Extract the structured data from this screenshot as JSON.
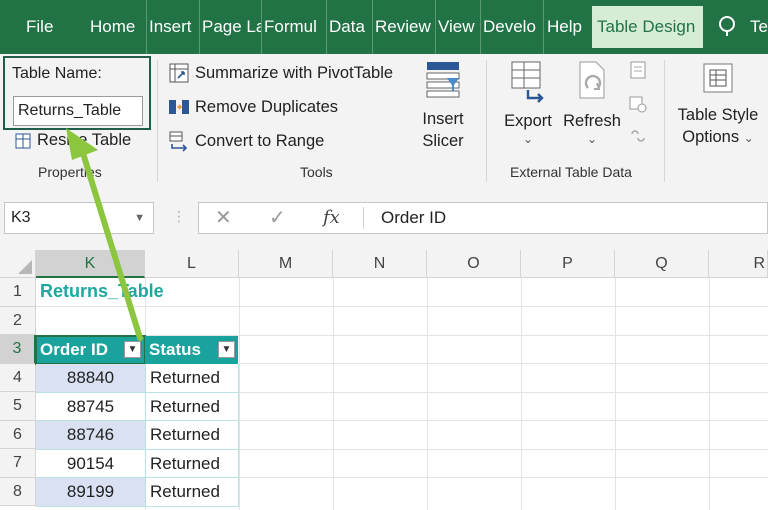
{
  "ribbon": {
    "tabs": [
      "File",
      "Home",
      "Insert",
      "Page La",
      "Formul",
      "Data",
      "Review",
      "View",
      "Develo",
      "Help",
      "Table Design",
      "Te"
    ],
    "properties": {
      "table_name_label": "Table Name:",
      "table_name_value": "Returns_Table",
      "resize_table": "Resize Table",
      "group_label": "Properties"
    },
    "tools": {
      "summarize": "Summarize with PivotTable",
      "remove_duplicates": "Remove Duplicates",
      "convert_to_range": "Convert to Range",
      "insert_slicer_line1": "Insert",
      "insert_slicer_line2": "Slicer",
      "group_label": "Tools"
    },
    "external": {
      "export": "Export",
      "refresh": "Refresh",
      "group_label": "External Table Data"
    },
    "style_options": {
      "line1": "Table Style",
      "line2": "Options"
    }
  },
  "formula_bar": {
    "name_box": "K3",
    "formula": "Order ID",
    "fx_label": "fx"
  },
  "grid": {
    "columns": [
      "K",
      "L",
      "M",
      "N",
      "O",
      "P",
      "Q",
      "R"
    ],
    "rows": [
      "1",
      "2",
      "3",
      "4",
      "5",
      "6",
      "7",
      "8"
    ],
    "title": "Returns_Table",
    "table_headers": [
      "Order ID",
      "Status"
    ],
    "table_rows": [
      [
        "88840",
        "Returned"
      ],
      [
        "88745",
        "Returned"
      ],
      [
        "88746",
        "Returned"
      ],
      [
        "90154",
        "Returned"
      ],
      [
        "89199",
        "Returned"
      ]
    ]
  },
  "colors": {
    "excel_green": "#217346",
    "table_header": "#1aa39c",
    "title_teal": "#1fa7a0",
    "band_blue": "#d9e1f2",
    "arrow_green": "#8cc63f"
  }
}
